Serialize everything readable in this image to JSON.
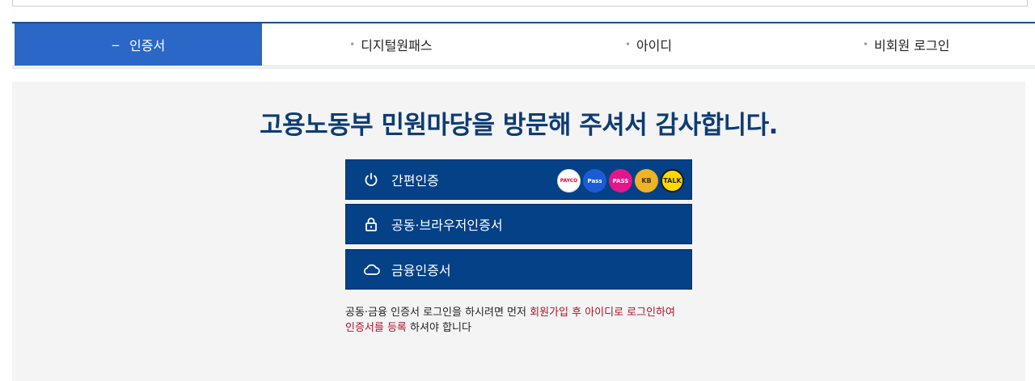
{
  "tabs": [
    {
      "label": "인증서",
      "active": true
    },
    {
      "label": "디지털원패스",
      "active": false
    },
    {
      "label": "아이디",
      "active": false
    },
    {
      "label": "비회원 로그인",
      "active": false
    }
  ],
  "headline": "고용노동부 민원마당을 방문해 주셔서 감사합니다.",
  "buttons": {
    "simple": {
      "label": "간편인증",
      "icon": "power-icon"
    },
    "joint": {
      "label": "공동·브라우저인증서",
      "icon": "lock-icon"
    },
    "finance": {
      "label": "금융인증서",
      "icon": "cloud-icon"
    }
  },
  "providers": [
    {
      "name": "PAYCO",
      "color": "#e4002b"
    },
    {
      "name": "Pass",
      "color": "#1b5cd6"
    },
    {
      "name": "PASS",
      "color": "#e2178a"
    },
    {
      "name": "KB",
      "color": "#f0b323"
    },
    {
      "name": "TALK",
      "color": "#ffd900"
    }
  ],
  "notice": {
    "part1": "공동·금융 인증서 로그인을 하시려면 먼저 ",
    "red1": "회원가입 후 아이디로 로그인하여",
    "red2": "인증서를 등록",
    "part2": " 하셔야 합니다"
  },
  "colors": {
    "primary": "#044187",
    "tab_active": "#2a67c6",
    "headline": "#0d3c73",
    "notice_red": "#b0102a"
  }
}
